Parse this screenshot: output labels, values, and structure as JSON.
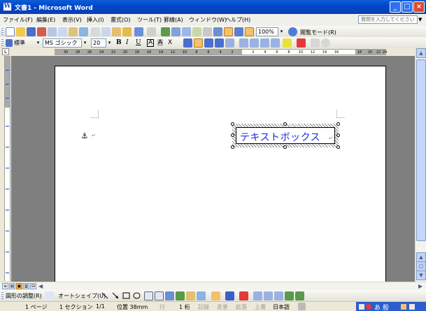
{
  "window": {
    "title": "文書1 - Microsoft Word",
    "app_icon": "W",
    "buttons": {
      "minimize": "_",
      "maximize": "□",
      "close": "×"
    }
  },
  "menu": {
    "items": [
      "ファイル(F)",
      "編集(E)",
      "表示(V)",
      "挿入(I)",
      "書式(O)",
      "ツール(T)",
      "罫線(A)",
      "ウィンドウ(W)",
      "ヘルプ(H)"
    ],
    "help_placeholder": "質問を入力してください",
    "help_arrow": "▼"
  },
  "standard_toolbar": {
    "zoom": "100%",
    "reading_mode": "閲覧モード(R)"
  },
  "formatting_toolbar": {
    "style": "標準",
    "font": "MS ゴシック",
    "size": "20",
    "bold": "B",
    "italic": "I",
    "underline": "U",
    "char_border": "A",
    "char_shade": "A",
    "char_scale": "X"
  },
  "ruler": {
    "ticks": [
      "30",
      "28",
      "26",
      "24",
      "22",
      "20",
      "18",
      "16",
      "14",
      "12",
      "10",
      "8",
      "6",
      "4",
      "2",
      "2",
      "4",
      "6",
      "8",
      "10",
      "12",
      "14",
      "16",
      "18",
      "20",
      "22",
      "24"
    ],
    "tab_selector": "L"
  },
  "document": {
    "anchor_symbol": "⚓",
    "paragraph_mark": "↵",
    "textbox_text": "テキストボックス"
  },
  "scrollbars": {
    "up": "▲",
    "down": "▼",
    "left": "◀",
    "right": "▶"
  },
  "view_buttons": [
    "≡",
    "▤",
    "▣",
    "▥",
    "⊟"
  ],
  "drawing_toolbar": {
    "draw_label": "図形の調整(R)",
    "autoshape_label": "オートシェイプ(U)"
  },
  "status": {
    "page": "1 ページ",
    "section": "1 セクション",
    "page_of": "1/1",
    "position": "位置 38mm",
    "line": "行",
    "column": "1 桁",
    "rec": "記録",
    "trk": "変更",
    "ext": "拡張",
    "ovr": "上書",
    "language": "日本語",
    "ime_text": "あ 般"
  },
  "colors": {
    "titlebar": "#0046c9",
    "textbox_text": "#1b2ed8",
    "workspace": "#7f7f7f",
    "highlight": "#f5c06a"
  }
}
